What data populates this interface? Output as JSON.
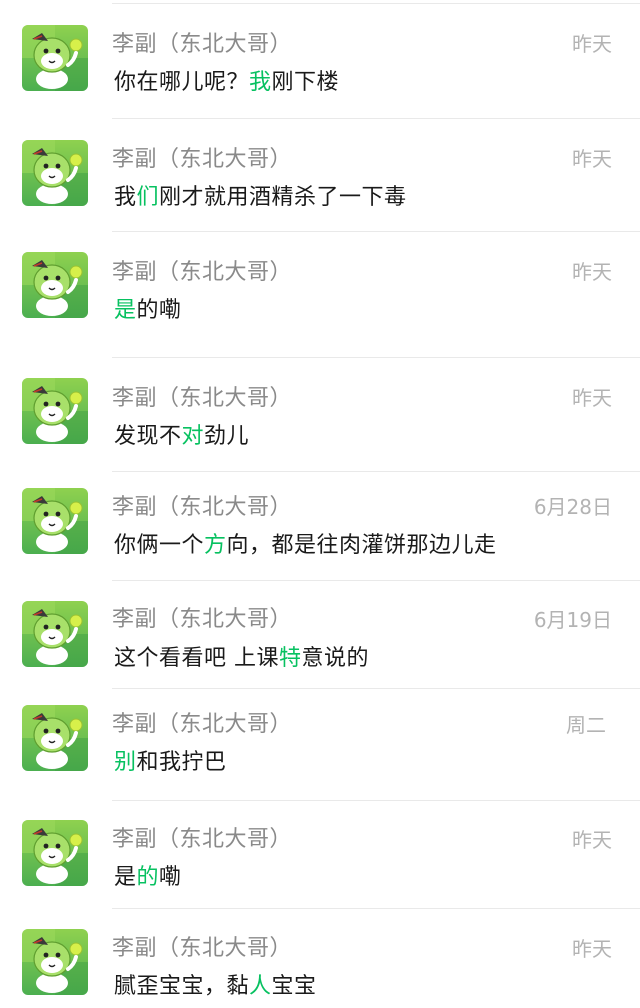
{
  "contact_name": "李副（东北大哥）",
  "highlight_color": "#07c160",
  "avatar_icon": "green-dinosaur-avatar-icon",
  "results": [
    {
      "time": "昨天",
      "pre": "你在哪儿呢？",
      "hl": "我",
      "post": "刚下楼"
    },
    {
      "time": "昨天",
      "pre": "我",
      "hl": "们",
      "post": "刚才就用酒精杀了一下毒"
    },
    {
      "time": "昨天",
      "pre": "",
      "hl": "是",
      "post": "的嘞"
    },
    {
      "time": "昨天",
      "pre": "发现不",
      "hl": "对",
      "post": "劲儿"
    },
    {
      "time": "6月28日",
      "pre": "你俩一个",
      "hl": "方",
      "post": "向，都是往肉灌饼那边儿走"
    },
    {
      "time": "6月19日",
      "pre": "这个看看吧  上课",
      "hl": "特",
      "post": "意说的"
    },
    {
      "time": "周二",
      "pre": "",
      "hl": "别",
      "post": "和我拧巴"
    },
    {
      "time": "昨天",
      "pre": "是",
      "hl": "的",
      "post": "嘞"
    },
    {
      "time": "昨天",
      "pre": "腻歪宝宝，黏",
      "hl": "人",
      "post": "宝宝"
    }
  ]
}
